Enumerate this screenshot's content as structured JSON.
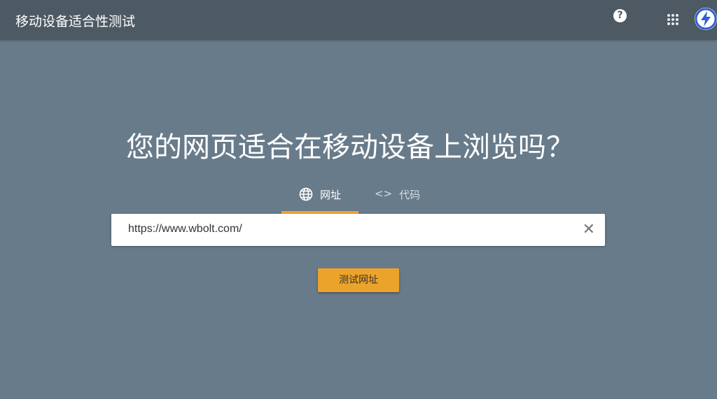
{
  "header": {
    "title": "移动设备适合性测试",
    "help_icon": "help-circle-icon",
    "apps_icon": "apps-grid-icon",
    "avatar_icon": "lightning-bolt-logo"
  },
  "main": {
    "headline": "您的网页适合在移动设备上浏览吗？",
    "tabs": [
      {
        "label": "网址",
        "icon": "globe-icon",
        "active": true
      },
      {
        "label": "代码",
        "icon": "code-icon",
        "active": false
      }
    ],
    "url_input": {
      "value": "https://www.wbolt.com/"
    },
    "submit_label": "测试网址"
  },
  "colors": {
    "header": "#4d5a64",
    "background": "#687b8a",
    "accent": "#eca32a"
  }
}
